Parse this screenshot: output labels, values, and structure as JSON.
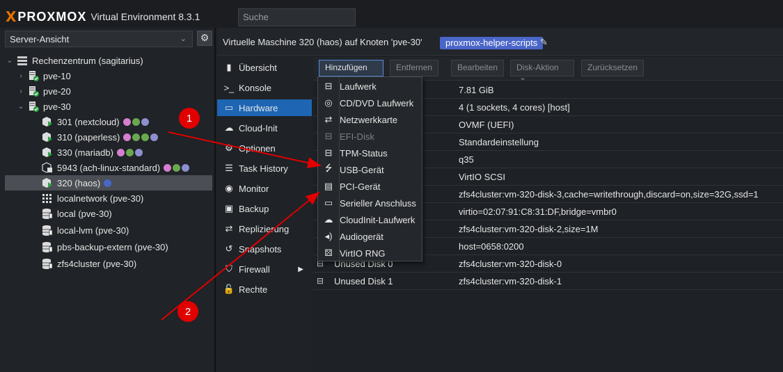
{
  "app": {
    "brand_x": "X",
    "brand": "PROXMOX",
    "product": "Virtual Environment 8.3.1",
    "search_placeholder": "Suche"
  },
  "left": {
    "view": "Server-Ansicht",
    "tree": [
      {
        "label": "Rechenzentrum (sagitarius)",
        "icon": "datacenter-icon"
      },
      {
        "label": "pve-10",
        "icon": "node-online-icon"
      },
      {
        "label": "pve-20",
        "icon": "node-online-icon"
      },
      {
        "label": "pve-30",
        "icon": "node-online-icon"
      },
      {
        "label": "301 (nextcloud)",
        "icon": "vm-running-icon",
        "tags": [
          "#d67fcf",
          "#6aa84f",
          "#8e8ed0"
        ]
      },
      {
        "label": "310 (paperless)",
        "icon": "vm-running-icon",
        "tags": [
          "#d67fcf",
          "#6aa84f",
          "#6aa84f",
          "#8e8ed0"
        ]
      },
      {
        "label": "330 (mariadb)",
        "icon": "vm-running-icon",
        "tags": [
          "#d67fcf",
          "#6aa84f",
          "#8e8ed0"
        ]
      },
      {
        "label": "5943 (ach-linux-standard)",
        "icon": "template-icon",
        "tags": [
          "#d67fcf",
          "#6aa84f",
          "#8e8ed0"
        ]
      },
      {
        "label": "320 (haos)",
        "icon": "vm-running-icon",
        "tags": [
          "#4a66c9"
        ]
      },
      {
        "label": "localnetwork (pve-30)",
        "icon": "sdn-grid-icon"
      },
      {
        "label": "local (pve-30)",
        "icon": "storage-icon"
      },
      {
        "label": "local-lvm (pve-30)",
        "icon": "storage-icon"
      },
      {
        "label": "pbs-backup-extern (pve-30)",
        "icon": "storage-icon"
      },
      {
        "label": "zfs4cluster (pve-30)",
        "icon": "storage-icon"
      }
    ]
  },
  "header": {
    "title": "Virtuelle Maschine 320 (haos) auf Knoten 'pve-30'",
    "tag": "proxmox-helper-scripts"
  },
  "nav": [
    {
      "label": "Übersicht",
      "icon": "book-icon"
    },
    {
      "label": "Konsole",
      "icon": "terminal-icon"
    },
    {
      "label": "Hardware",
      "icon": "desktop-icon"
    },
    {
      "label": "Cloud-Init",
      "icon": "cloud-icon"
    },
    {
      "label": "Optionen",
      "icon": "gear-icon"
    },
    {
      "label": "Task History",
      "icon": "list-icon"
    },
    {
      "label": "Monitor",
      "icon": "eye-icon"
    },
    {
      "label": "Backup",
      "icon": "floppy-icon"
    },
    {
      "label": "Replizierung",
      "icon": "retweet-icon"
    },
    {
      "label": "Snapshots",
      "icon": "history-icon"
    },
    {
      "label": "Firewall",
      "icon": "shield-icon"
    },
    {
      "label": "Rechte",
      "icon": "unlock-icon"
    }
  ],
  "toolbar": {
    "add": "Hinzufügen",
    "remove": "Entfernen",
    "edit": "Bearbeiten",
    "disk_action": "Disk-Aktion",
    "revert": "Zurücksetzen"
  },
  "grid": [
    {
      "key": "",
      "value": "7.81 GiB"
    },
    {
      "key": "",
      "value": "4 (1 sockets, 4 cores) [host]"
    },
    {
      "key": "",
      "value": "OVMF (UEFI)"
    },
    {
      "key": "",
      "value": "Standardeinstellung"
    },
    {
      "key": "",
      "value": "q35"
    },
    {
      "key": "",
      "value": "VirtIO SCSI"
    },
    {
      "key": "",
      "value": "zfs4cluster:vm-320-disk-3,cache=writethrough,discard=on,size=32G,ssd=1"
    },
    {
      "key": "",
      "value": "virtio=02:07:91:C8:31:DF,bridge=vmbr0"
    },
    {
      "key": "",
      "value": "zfs4cluster:vm-320-disk-2,size=1M"
    },
    {
      "key": "",
      "value": "host=0658:0200"
    },
    {
      "key": "Unused Disk 0",
      "value": "zfs4cluster:vm-320-disk-0"
    },
    {
      "key": "Unused Disk 1",
      "value": "zfs4cluster:vm-320-disk-1"
    }
  ],
  "menu": [
    {
      "label": "Laufwerk",
      "icon": "hdd-icon",
      "disabled": false
    },
    {
      "label": "CD/DVD Laufwerk",
      "icon": "cdrom-icon",
      "disabled": false
    },
    {
      "label": "Netzwerkkarte",
      "icon": "exchange-icon",
      "disabled": false
    },
    {
      "label": "EFI-Disk",
      "icon": "hdd-icon",
      "disabled": true
    },
    {
      "label": "TPM-Status",
      "icon": "hdd-icon",
      "disabled": false
    },
    {
      "label": "USB-Gerät",
      "icon": "usb-icon",
      "disabled": false
    },
    {
      "label": "PCI-Gerät",
      "icon": "pci-card-icon",
      "disabled": false
    },
    {
      "label": "Serieller Anschluss",
      "icon": "serial-port-icon",
      "disabled": false
    },
    {
      "label": "CloudInit-Laufwerk",
      "icon": "cloud-icon",
      "disabled": false
    },
    {
      "label": "Audiogerät",
      "icon": "volume-icon",
      "disabled": false
    },
    {
      "label": "VirtIO RNG",
      "icon": "dice-icon",
      "disabled": false
    }
  ],
  "annotations": [
    {
      "label": "1"
    },
    {
      "label": "2"
    }
  ],
  "colors": {
    "accent": "#1e66b4",
    "brand_orange": "#e57000",
    "tag_blue": "#4a66c9",
    "node_green": "#2ea043",
    "annotation_red": "#e00000"
  }
}
